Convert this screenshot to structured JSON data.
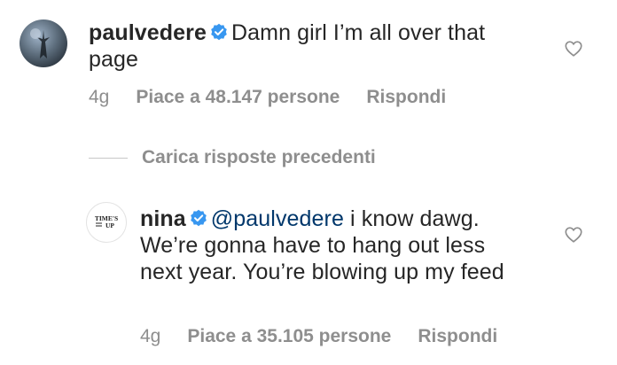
{
  "main_comment": {
    "username": "paulvedere",
    "text": "Damn girl I’m all over that page",
    "age": "4g",
    "likes": "Piace a 48.147 persone",
    "reply_label": "Rispondi"
  },
  "load_previous_replies": "Carica risposte precedenti",
  "reply_comment": {
    "username": "nina",
    "mention": "@paulvedere",
    "text": " i know dawg. We’re gonna have to hang out less next year. You’re blowing up my feed",
    "age": "4g",
    "likes": "Piace a 35.105 persone",
    "reply_label": "Rispondi",
    "avatar_logo_text": "TIME'S UP"
  },
  "colors": {
    "text": "#262626",
    "meta": "#8e8e8e",
    "verified_badge": "#3897f0",
    "mention": "#00376b"
  },
  "icons": {
    "verified": "verified-badge-icon",
    "like": "heart-outline-icon"
  }
}
